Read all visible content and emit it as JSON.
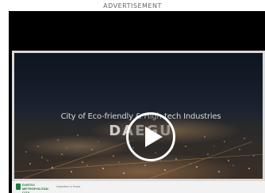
{
  "ad": {
    "label": "ADVERTISEMENT"
  },
  "video": {
    "headline": "City of Eco-friendly & High-tech Industries",
    "city_name": "DAEGU",
    "play_icon": "play-icon",
    "scene": "night city aerial view"
  },
  "brand": {
    "logo_top": "DAEGU",
    "logo_bottom": "METROPOLITAN CITY",
    "tagline": "Inspiration in Korea",
    "logo_color": "#1e7a3a"
  }
}
